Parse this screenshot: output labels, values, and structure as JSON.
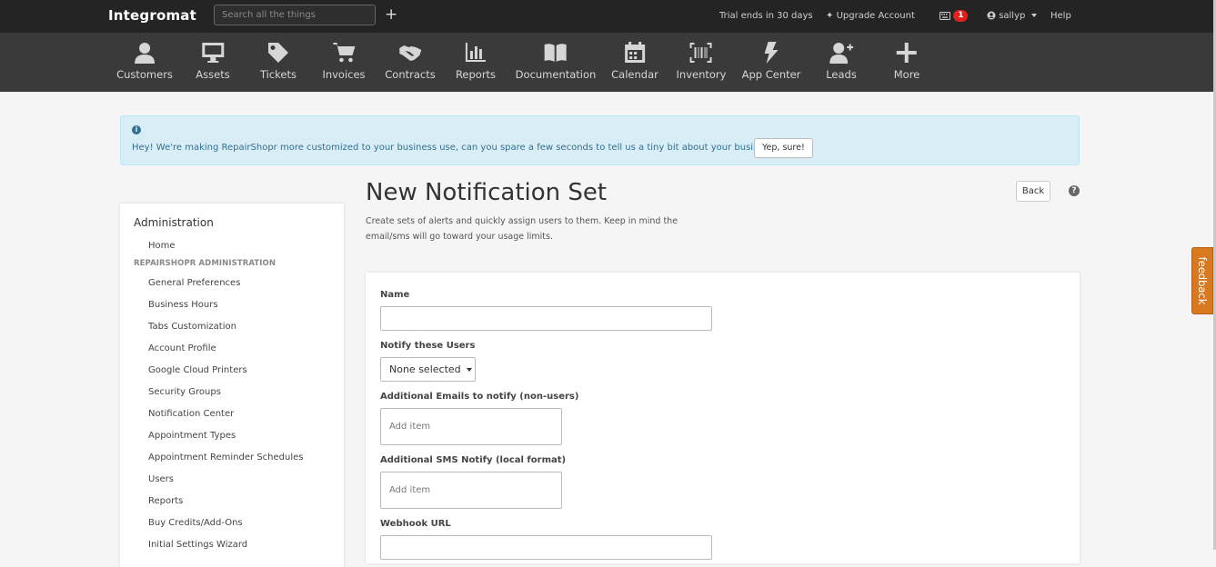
{
  "topbar": {
    "brand": "Integromat",
    "search_placeholder": "Search all the things",
    "plus_label": "+",
    "trial": "Trial ends in 30 days",
    "upgrade": "Upgrade Account",
    "notifications_count": "1",
    "user": "sallyp",
    "help": "Help"
  },
  "nav": {
    "items": [
      {
        "label": "Customers",
        "icon": "user-icon"
      },
      {
        "label": "Assets",
        "icon": "monitor-icon"
      },
      {
        "label": "Tickets",
        "icon": "tag-icon"
      },
      {
        "label": "Invoices",
        "icon": "cart-icon"
      },
      {
        "label": "Contracts",
        "icon": "handshake-icon"
      },
      {
        "label": "Reports",
        "icon": "bar-chart-icon"
      },
      {
        "label": "Documentation",
        "icon": "book-icon"
      },
      {
        "label": "Calendar",
        "icon": "calendar-icon"
      },
      {
        "label": "Inventory",
        "icon": "barcode-icon"
      },
      {
        "label": "App Center",
        "icon": "bolt-icon"
      },
      {
        "label": "Leads",
        "icon": "user-plus-icon"
      },
      {
        "label": "More",
        "icon": "plus-icon"
      }
    ]
  },
  "alert": {
    "message": "Hey! We're making RepairShopr more customized to your business use, can you spare a few seconds to tell us a tiny bit about your business?",
    "button": "Yep, sure!"
  },
  "sidebar": {
    "title": "Administration",
    "home": "Home",
    "section": "RepairShopr Administration",
    "items": [
      "General Preferences",
      "Business Hours",
      "Tabs Customization",
      "Account Profile",
      "Google Cloud Printers",
      "Security Groups",
      "Notification Center",
      "Appointment Types",
      "Appointment Reminder Schedules",
      "Users",
      "Reports",
      "Buy Credits/Add-Ons",
      "Initial Settings Wizard"
    ]
  },
  "page": {
    "title": "New Notification Set",
    "description": "Create sets of alerts and quickly assign users to them. Keep in mind the email/sms will go toward your usage limits.",
    "back": "Back"
  },
  "form": {
    "name_label": "Name",
    "name_value": "",
    "users_label": "Notify these Users",
    "users_selected": "None selected",
    "emails_label": "Additional Emails to notify (non-users)",
    "emails_placeholder": "Add item",
    "sms_label": "Additional SMS Notify (local format)",
    "sms_placeholder": "Add item",
    "webhook_label": "Webhook URL",
    "webhook_value": ""
  },
  "feedback": "feedback",
  "colors": {
    "topbar_bg": "#242424",
    "nav_bg": "#3a3a3a",
    "alert_bg": "#d9edf7",
    "alert_text": "#31708f",
    "feedback_bg": "#d8781f",
    "badge": "#e0201b"
  }
}
